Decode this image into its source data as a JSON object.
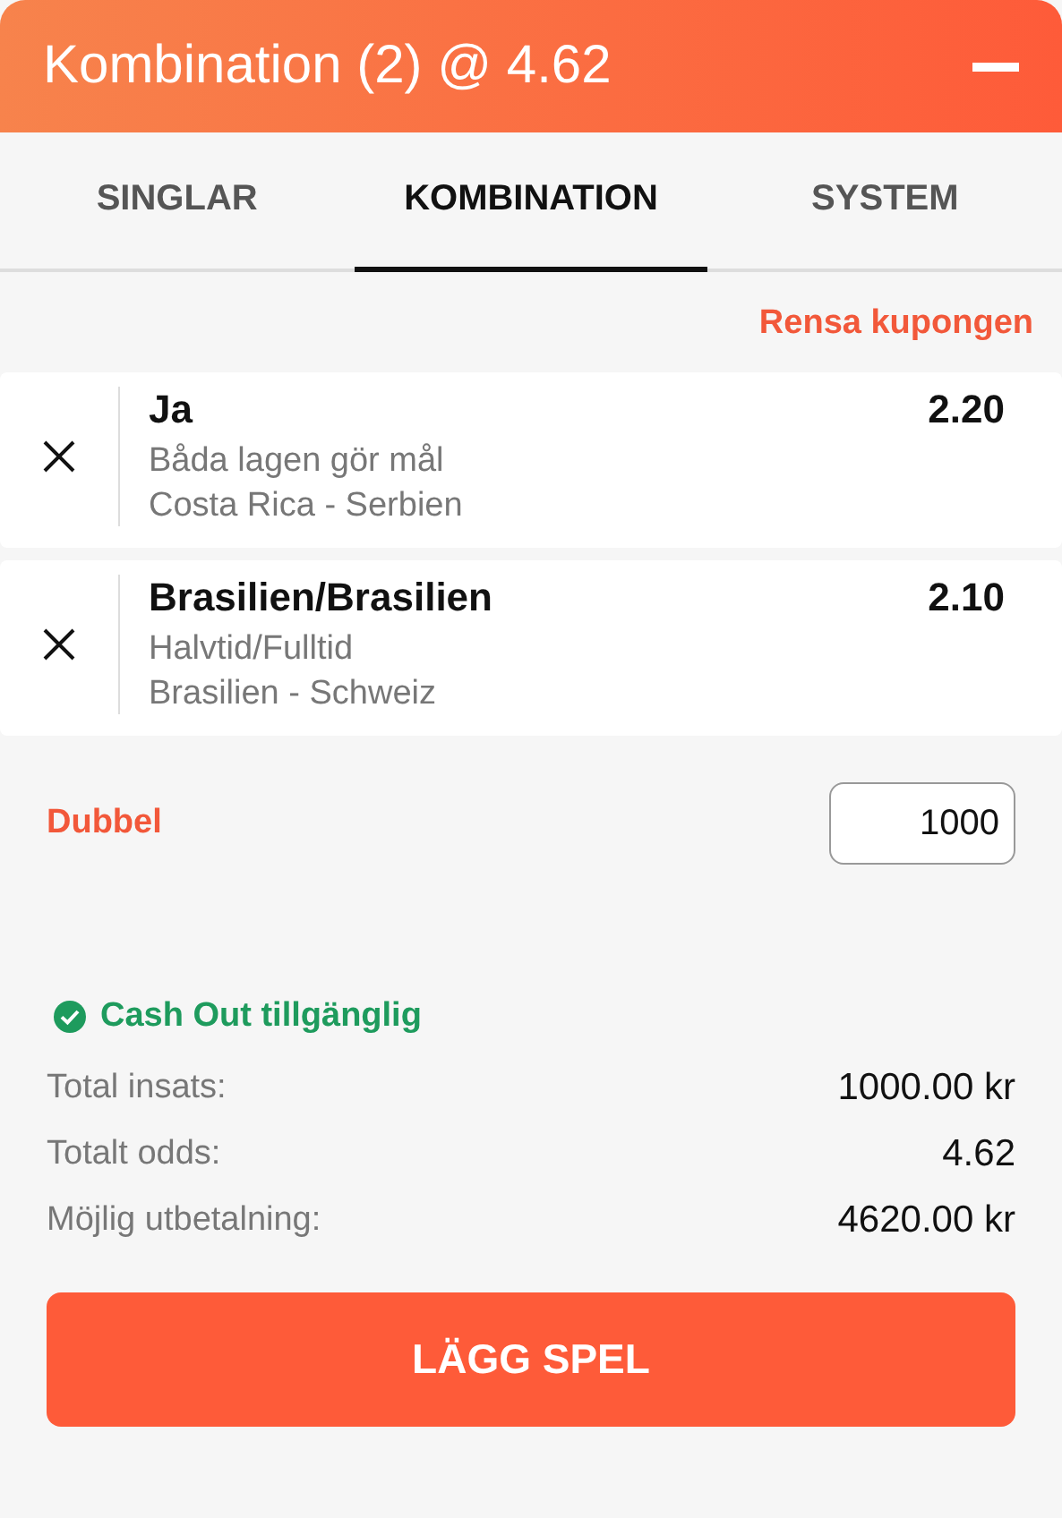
{
  "header": {
    "title": "Kombination (2) @ 4.62"
  },
  "tabs": [
    {
      "label": "SINGLAR",
      "selected": false
    },
    {
      "label": "KOMBINATION",
      "selected": true
    },
    {
      "label": "SYSTEM",
      "selected": false
    }
  ],
  "clear_link": "Rensa kupongen",
  "selections": [
    {
      "pick": "Ja",
      "odds": "2.20",
      "market": "Båda lagen gör mål",
      "match": "Costa Rica - Serbien"
    },
    {
      "pick": "Brasilien/Brasilien",
      "odds": "2.10",
      "market": "Halvtid/Fulltid",
      "match": "Brasilien - Schweiz"
    }
  ],
  "stake": {
    "label": "Dubbel",
    "value": "1000"
  },
  "cash_out": {
    "label": "Cash Out tillgänglig",
    "available": true
  },
  "summary": [
    {
      "label": "Total insats:",
      "value": "1000.00 kr"
    },
    {
      "label": "Totalt odds:",
      "value": "4.62"
    },
    {
      "label": "Möjlig utbetalning:",
      "value": "4620.00 kr"
    }
  ],
  "place_button": "LÄGG SPEL"
}
